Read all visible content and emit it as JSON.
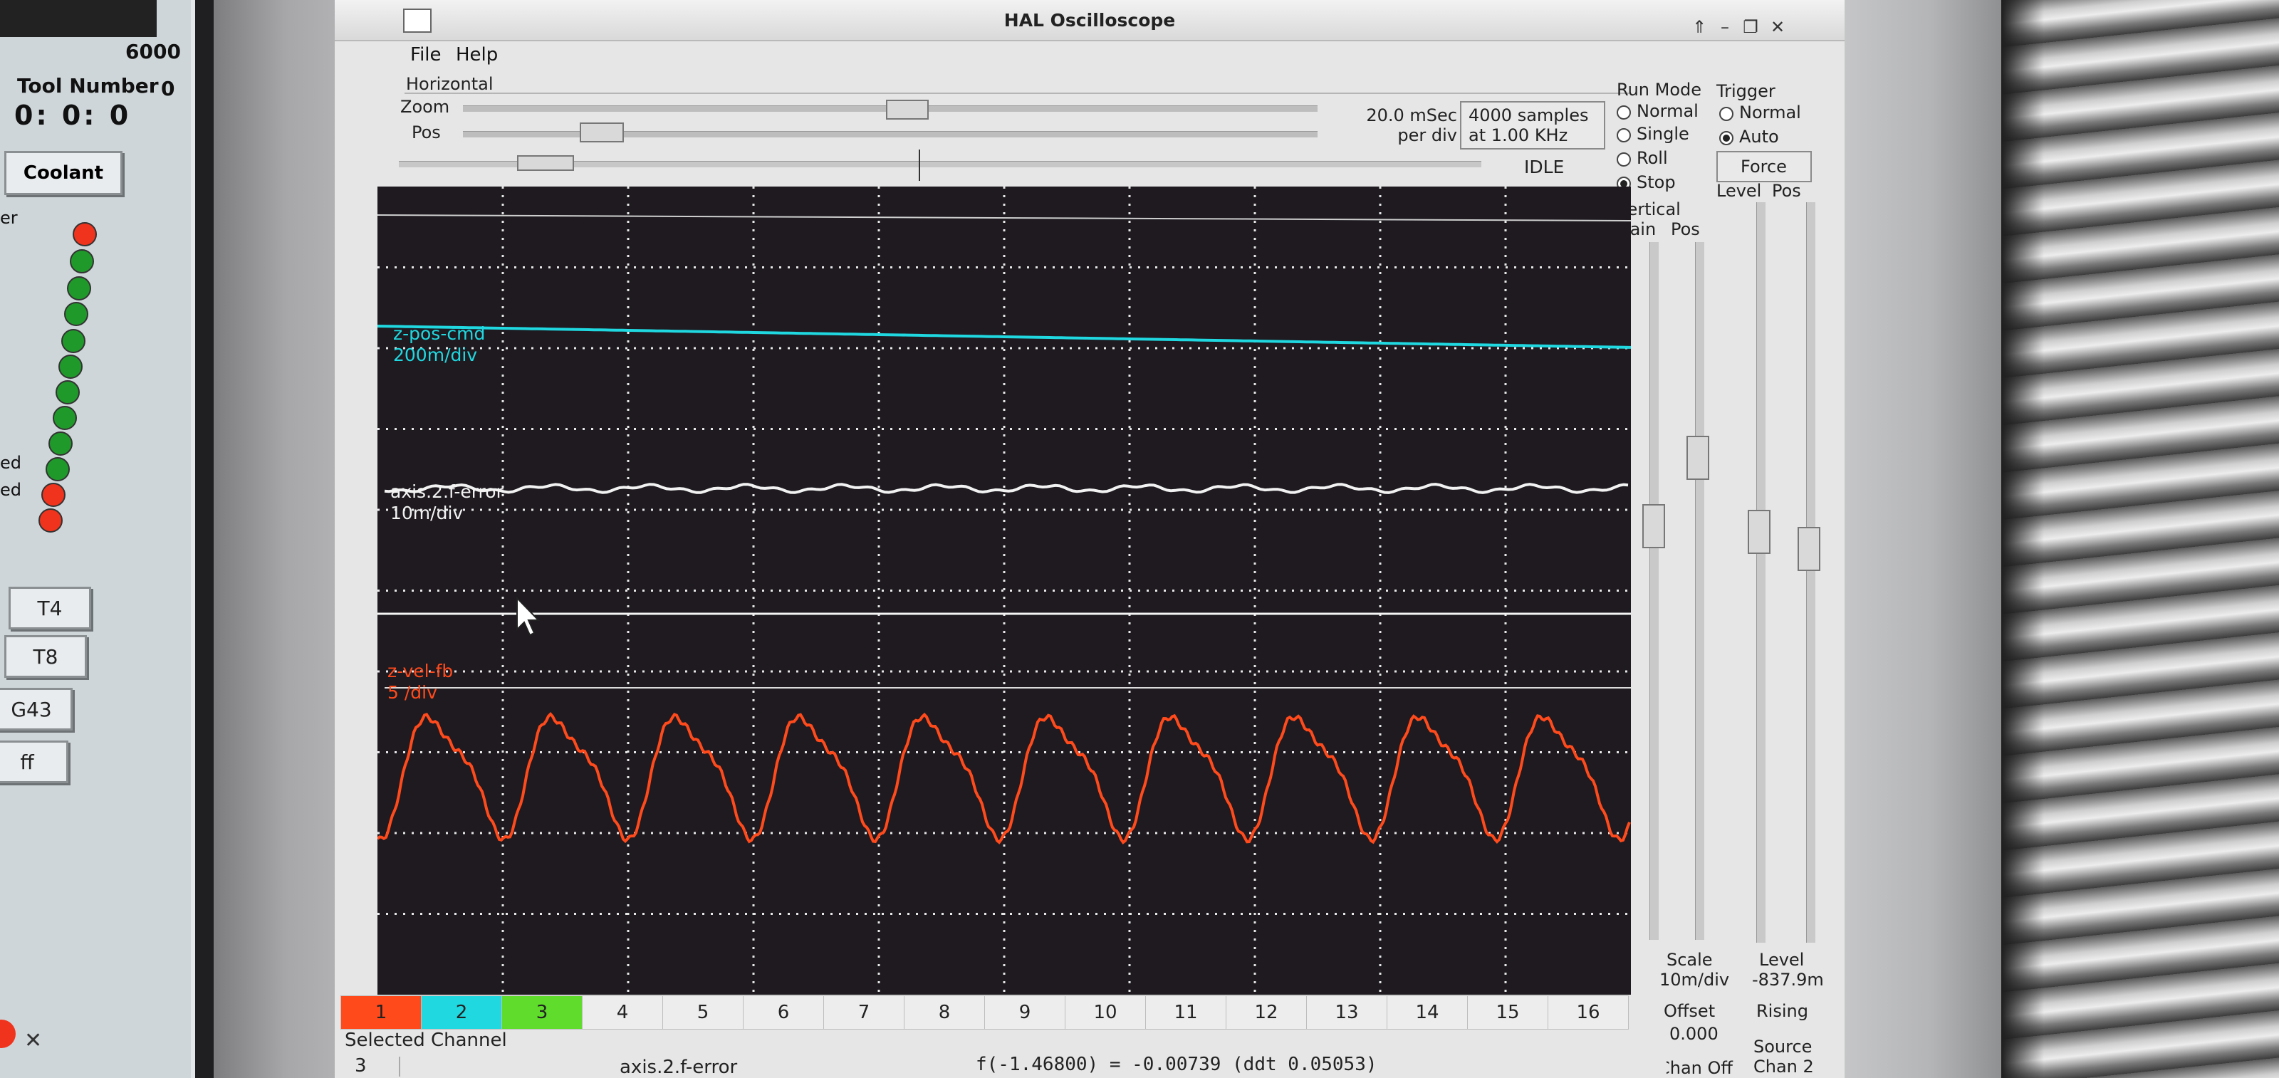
{
  "window": {
    "title": "HAL Oscilloscope"
  },
  "menu": {
    "file": "File",
    "help": "Help"
  },
  "horizontal": {
    "section_label": "Horizontal",
    "zoom_label": "Zoom",
    "pos_label": "Pos",
    "scale_line1": "20.0 mSec",
    "scale_line2": "per div",
    "samples_line1": "4000 samples",
    "samples_line2": "at 1.00 KHz",
    "state": "IDLE"
  },
  "run_mode": {
    "label": "Run Mode",
    "options": [
      "Normal",
      "Single",
      "Roll",
      "Stop"
    ],
    "selected": "Stop"
  },
  "trigger": {
    "label": "Trigger",
    "options": [
      "Normal",
      "Auto"
    ],
    "selected": "Auto",
    "force_label": "Force",
    "level_label": "Level",
    "pos_label": "Pos",
    "level_title": "Level",
    "level_value": "-837.9m",
    "edge": "Rising",
    "source_label": "Source",
    "source_value": "Chan 2"
  },
  "vertical": {
    "label": "Vertical",
    "gain_label": "Gain",
    "pos_label": "Pos",
    "scale_label": "Scale",
    "scale_value": "10m/div",
    "offset_label": "Offset",
    "offset_value": "0.000",
    "chan_off": "Chan Off"
  },
  "traces": [
    {
      "name": "z-pos-cmd",
      "scale": "200m/div",
      "color": "#1fd8e0"
    },
    {
      "name": "axis.2.f-error",
      "scale": "10m/div",
      "color": "#f2f2f2"
    },
    {
      "name": "z-vel-fb",
      "scale": "5 /div",
      "color": "#ff4a1c"
    }
  ],
  "channel_tabs": [
    {
      "label": "1",
      "color": "#ff4a1c"
    },
    {
      "label": "2",
      "color": "#1fd8e0"
    },
    {
      "label": "3",
      "color": "#5fdc2c"
    },
    {
      "label": "4",
      "color": ""
    },
    {
      "label": "5",
      "color": ""
    },
    {
      "label": "6",
      "color": ""
    },
    {
      "label": "7",
      "color": ""
    },
    {
      "label": "8",
      "color": ""
    },
    {
      "label": "9",
      "color": ""
    },
    {
      "label": "10",
      "color": ""
    },
    {
      "label": "11",
      "color": ""
    },
    {
      "label": "12",
      "color": ""
    },
    {
      "label": "13",
      "color": ""
    },
    {
      "label": "14",
      "color": ""
    },
    {
      "label": "15",
      "color": ""
    },
    {
      "label": "16",
      "color": ""
    }
  ],
  "selected_channel": {
    "label": "Selected Channel",
    "number": "3",
    "signal": "axis.2.f-error",
    "readout": "f(-1.46800) = -0.00739 (ddt  0.05053)"
  },
  "left_panel": {
    "value_top": "6000",
    "tool_number_label": "Tool Number",
    "tool_number_value": "0",
    "time_readout": "0: 0: 0",
    "coolant_button": "Coolant",
    "row_labels": [
      "er",
      "ed",
      "ed"
    ],
    "tool_buttons": [
      "T4",
      "T8",
      "G43",
      "ff"
    ],
    "close_glyph": "✕"
  }
}
